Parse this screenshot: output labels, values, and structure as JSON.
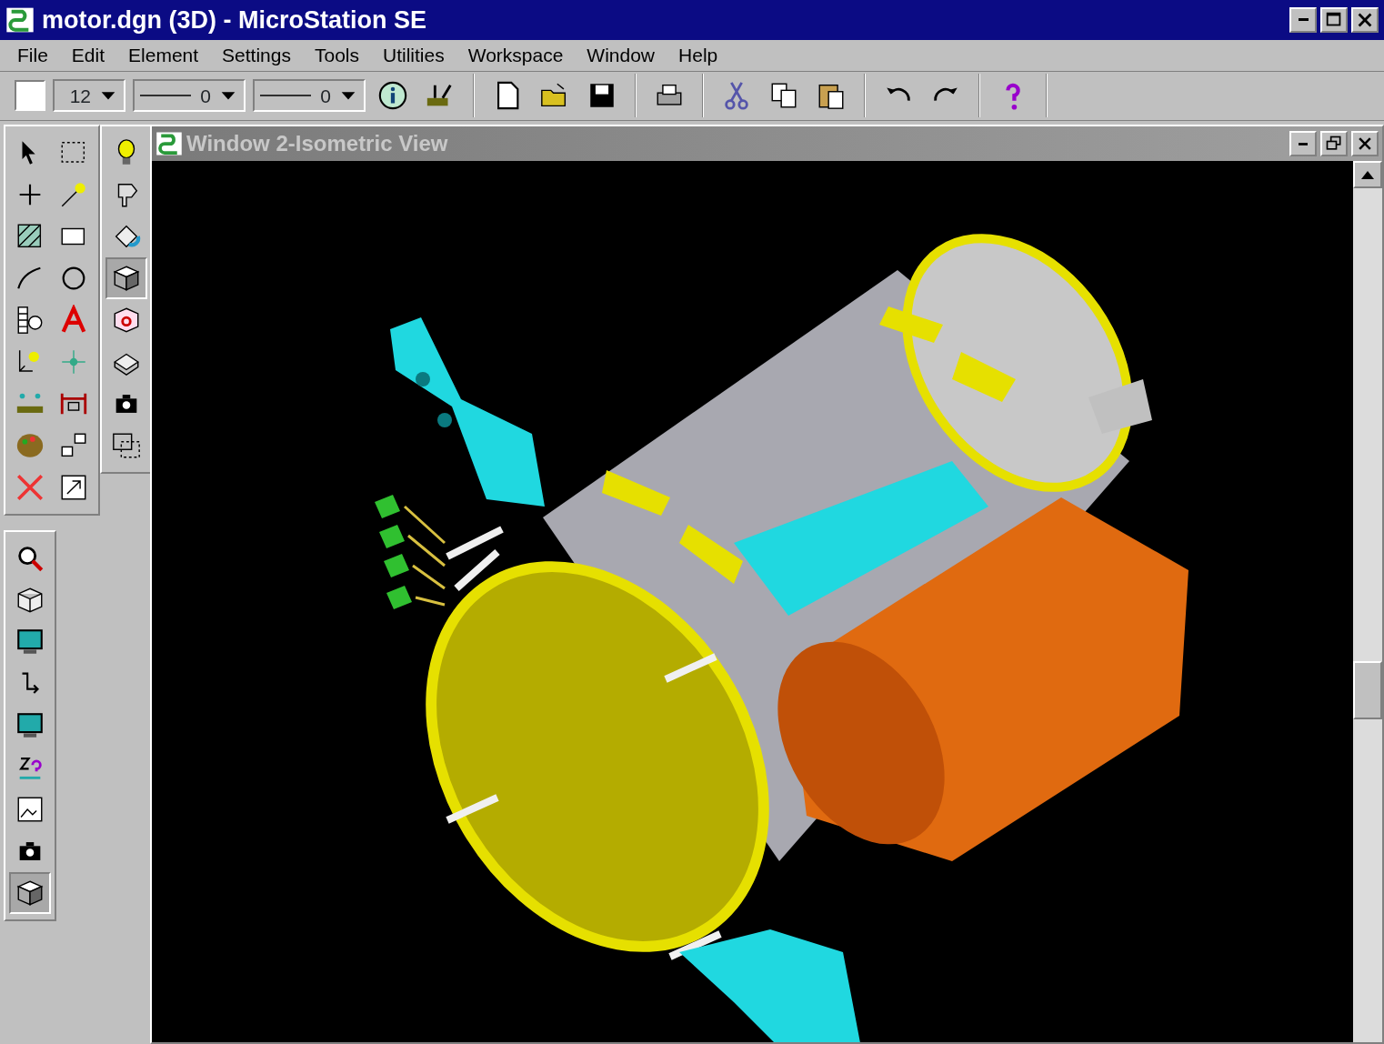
{
  "window": {
    "title": "motor.dgn (3D) - MicroStation SE"
  },
  "menu": [
    {
      "label": "File"
    },
    {
      "label": "Edit"
    },
    {
      "label": "Element"
    },
    {
      "label": "Settings"
    },
    {
      "label": "Tools"
    },
    {
      "label": "Utilities"
    },
    {
      "label": "Workspace"
    },
    {
      "label": "Window"
    },
    {
      "label": "Help"
    }
  ],
  "toolbar": {
    "level_combo": {
      "value": "12"
    },
    "line_style_combo": {
      "value": "0"
    },
    "line_weight_combo": {
      "value": "0"
    }
  },
  "main_palette": [
    {
      "selected": false
    },
    {
      "selected": false
    },
    {
      "selected": false
    },
    {
      "selected": false
    },
    {
      "selected": false
    },
    {
      "selected": false
    },
    {
      "selected": false
    },
    {
      "selected": false
    },
    {
      "selected": false
    },
    {
      "selected": false
    },
    {
      "selected": false
    },
    {
      "selected": false
    },
    {
      "selected": false
    },
    {
      "selected": false
    },
    {
      "selected": false
    },
    {
      "selected": false
    },
    {
      "selected": false
    },
    {
      "selected": false
    }
  ],
  "secondary_palette": [
    {
      "selected": false
    },
    {
      "selected": false
    },
    {
      "selected": false
    },
    {
      "selected": true
    },
    {
      "selected": false
    },
    {
      "selected": false
    },
    {
      "selected": false
    },
    {
      "selected": false
    }
  ],
  "view_palette": [
    {
      "selected": false
    },
    {
      "selected": false
    },
    {
      "selected": false
    },
    {
      "selected": false
    },
    {
      "selected": false
    },
    {
      "selected": false
    },
    {
      "selected": false
    },
    {
      "selected": false
    },
    {
      "selected": true
    }
  ],
  "view_window": {
    "title": "Window 2-Isometric View"
  }
}
